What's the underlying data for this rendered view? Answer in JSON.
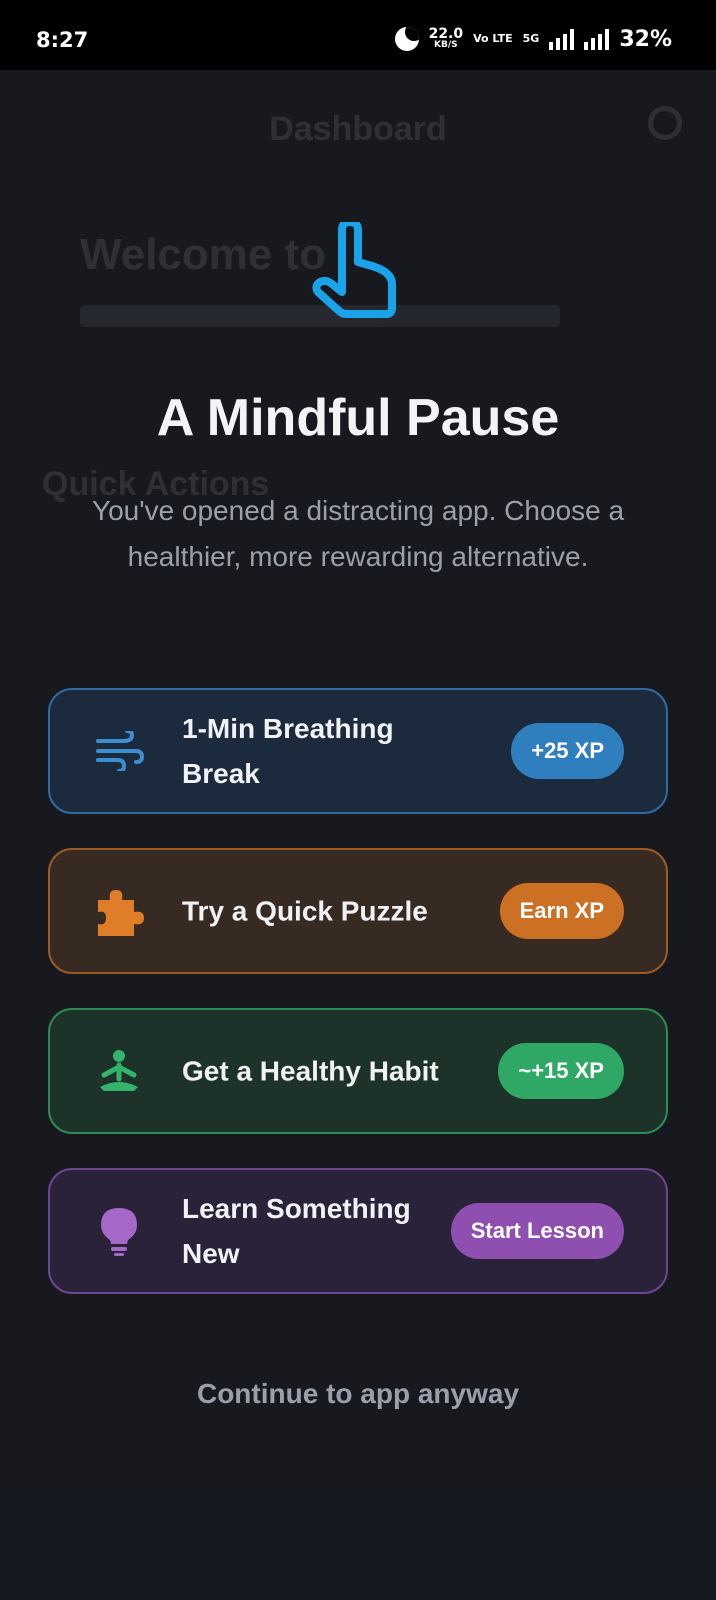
{
  "status_bar": {
    "time": "8:27",
    "net_speed": "22.0",
    "net_speed_unit": "KB/S",
    "volte": "Vo LTE",
    "network": "5G",
    "battery": "32%"
  },
  "background": {
    "title": "Dashboard",
    "welcome": "Welcome to",
    "quick_actions": "Quick Actions"
  },
  "overlay": {
    "title": "A Mindful Pause",
    "subtitle": "You've opened a distracting app. Choose a healthier, more rewarding alternative.",
    "options": [
      {
        "label": "1-Min Breathing Break",
        "badge": "+25 XP",
        "icon": "wind-icon",
        "color": "#2f7fbe"
      },
      {
        "label": "Try a Quick Puzzle",
        "badge": "Earn XP",
        "icon": "puzzle-icon",
        "color": "#cc7023"
      },
      {
        "label": "Get a Healthy Habit",
        "badge": "~+15 XP",
        "icon": "meditation-icon",
        "color": "#2fa865"
      },
      {
        "label": "Learn Something New",
        "badge": "Start Lesson",
        "icon": "lightbulb-icon",
        "color": "#8e4fb0"
      }
    ],
    "continue_label": "Continue to app anyway",
    "accent": "#1aa3e8"
  }
}
